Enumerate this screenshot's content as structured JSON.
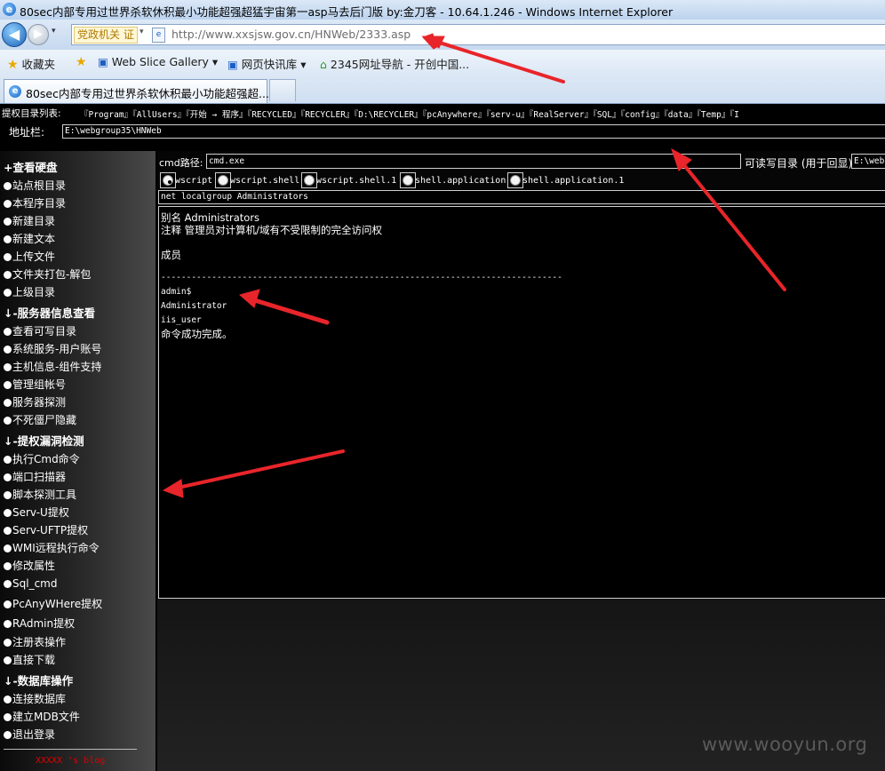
{
  "window": {
    "title": "80sec内部专用过世界杀软休积最小功能超强超猛宇宙第一asp马去后门版 by:金刀客 - 10.64.1.246 - Windows Internet Explorer",
    "ie_icon": "e"
  },
  "navigation": {
    "back_glyph": "◀",
    "forward_glyph": "▶",
    "dropdown_glyph": "▾",
    "gov_badge": "党政机关 证",
    "url": "http://www.xxsjsw.gov.cn/HNWeb/2333.asp"
  },
  "favorites_bar": {
    "favorites_label": "收藏夹",
    "items": [
      {
        "label": "Web Slice Gallery ▾"
      },
      {
        "label": "网页快讯库 ▾"
      },
      {
        "label": "2345网址导航 - 开创中国..."
      }
    ]
  },
  "tab": {
    "label": "80sec内部专用过世界杀软休积最小功能超强超..."
  },
  "page": {
    "dir_list_label": "提权目录列表:",
    "dir_list": "『Program』『AllUsers』『开始 → 程序』『RECYCLED』『RECYCLER』『D:\\RECYCLER』『pcAnywhere』『serv-u』『RealServer』『SQL』『config』『data』『Temp』『I",
    "address_label": "地址栏:",
    "address_value": "E:\\webgroup35\\HNWeb",
    "cmd_path_label": "cmd路径:",
    "cmd_path_value": "cmd.exe",
    "readwrite_label": "可读写目录 (用于回显)",
    "readwrite_value": "E:\\web",
    "radios": [
      {
        "label": "wscript",
        "selected": true
      },
      {
        "label": "wscript.shell",
        "selected": false
      },
      {
        "label": "wscript.shell.1",
        "selected": false
      },
      {
        "label": "shell.application",
        "selected": false
      },
      {
        "label": "shell.application.1",
        "selected": false
      }
    ],
    "command_line": "net localgroup Administrators",
    "output": [
      "别名     Administrators",
      "注释     管理员对计算机/域有不受限制的完全访问权",
      "成员",
      "-------------------------------------------------------------------------------",
      "admin$",
      "Administrator",
      "iis_user",
      "命令成功完成。"
    ]
  },
  "sidebar": {
    "sections": [
      {
        "title": "查看硬盘",
        "prefix": "+",
        "items": [
          "站点根目录",
          "本程序目录",
          "新建目录",
          "新建文本",
          "上传文件",
          "文件夹打包-解包",
          "上级目录"
        ]
      },
      {
        "title": "-服务器信息查看",
        "prefix": "↓",
        "items": [
          "查看可写目录",
          "系统服务-用户账号",
          "主机信息-组件支持",
          "管理组帐号",
          "服务器探测",
          "不死僵尸隐藏"
        ]
      },
      {
        "title": "-提权漏洞检测",
        "prefix": "↓",
        "items": [
          "执行Cmd命令",
          "端口扫描器",
          "脚本探测工具",
          "Serv-U提权",
          "Serv-UFTP提权",
          "WMI远程执行命令",
          "修改属性",
          "Sql_cmd",
          "PcAnyWHere提权",
          "RAdmin提权",
          "注册表操作",
          "直接下载"
        ]
      },
      {
        "title": "-数据库操作",
        "prefix": "↓",
        "items": [
          "连接数据库",
          "建立MDB文件",
          "退出登录"
        ]
      }
    ],
    "blog": "XXXXX 's blog"
  },
  "watermark": "www.wooyun.org",
  "colors": {
    "arrow": "#e8252a",
    "page_bg": "#000000",
    "blog_text": "#e00000"
  }
}
